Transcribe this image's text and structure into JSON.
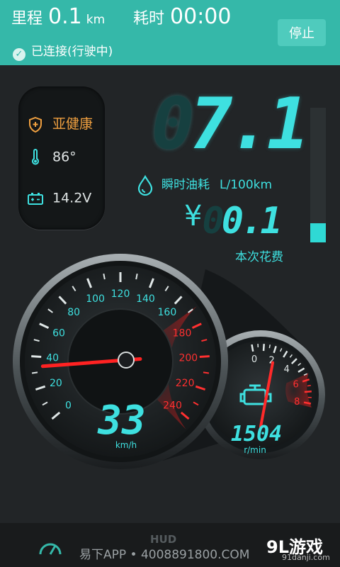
{
  "header": {
    "distance_label": "里程",
    "distance_value": "0.1",
    "distance_unit": "km",
    "time_label": "耗时",
    "time_value": "00:00",
    "stop_label": "停止",
    "status_text": "已连接(行驶中)"
  },
  "car_status": {
    "health": "亚健康",
    "temperature": "86°",
    "voltage": "14.2V"
  },
  "fuel": {
    "consumption_dim": "0",
    "consumption_value": "7.1",
    "consumption_label": "瞬时油耗",
    "consumption_unit": "L/100km",
    "currency_symbol": "¥",
    "cost_dim": "0",
    "cost_value": "0.1",
    "cost_label": "本次花费",
    "level_fraction": 0.14
  },
  "speedometer": {
    "labels": [
      "0",
      "20",
      "40",
      "60",
      "80",
      "100",
      "120",
      "140",
      "160",
      "180",
      "200",
      "220",
      "240"
    ],
    "speed_value": "33",
    "speed_unit": "km/h",
    "needle_value": 33
  },
  "tachometer": {
    "labels": [
      "0",
      "2",
      "4",
      "6",
      "8"
    ],
    "rpm_value": "1504",
    "rpm_unit": "r/min",
    "needle_value": 1.504
  },
  "footer": {
    "watermark": "易下APP • 4008891800.COM",
    "hud_label": "HUD",
    "brand": "9L游戏",
    "brand_site": "91danji.com"
  },
  "colors": {
    "header": "#35b8a9",
    "digits": "#3ee0e0",
    "health": "#f0a040",
    "redline": "#e02020"
  },
  "icons": [
    "check-icon",
    "shield-icon",
    "thermometer-icon",
    "battery-icon",
    "fuel-drop-icon",
    "engine-icon",
    "speedometer-icon"
  ]
}
